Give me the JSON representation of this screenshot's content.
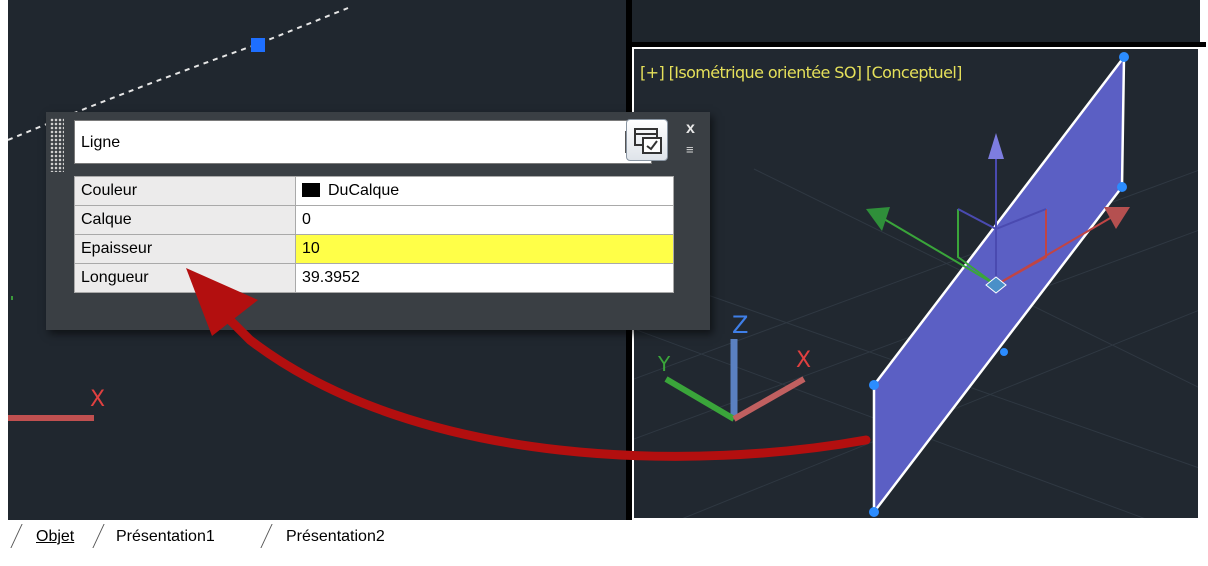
{
  "viewport_right": {
    "label": "[+] [Isométrique orientée SO] [Conceptuel]",
    "colors": {
      "background": "#212830",
      "label": "#e5e05a",
      "face": "#5b5fc4"
    }
  },
  "palette": {
    "object_type": "Ligne",
    "icons": {
      "grip": "grip-handle-icon",
      "dropdown": "chevron-down-icon",
      "quick_select": "quick-select-icon",
      "close": "close-icon",
      "options": "options-menu-icon"
    },
    "close_glyph": "x",
    "options_glyph": "≡",
    "dropdown_glyph": "▾",
    "properties": [
      {
        "name": "Couleur",
        "value": "DuCalque",
        "swatch": "#000000"
      },
      {
        "name": "Calque",
        "value": "0"
      },
      {
        "name": "Epaisseur",
        "value": "10",
        "highlight": "#ffff48"
      },
      {
        "name": "Longueur",
        "value": "39.3952"
      }
    ]
  },
  "tabs": [
    {
      "label": "Objet"
    },
    {
      "label": "Présentation1"
    },
    {
      "label": "Présentation2"
    }
  ],
  "annotation": {
    "arrow_color": "#b30f0f"
  }
}
